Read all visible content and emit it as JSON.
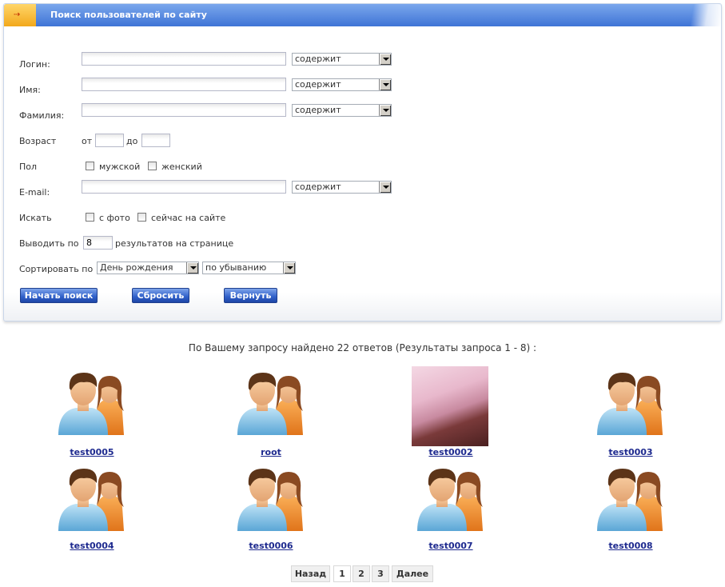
{
  "header": {
    "title": "Поиск пользователей по сайту",
    "arrow": "⇢"
  },
  "form": {
    "login": {
      "label": "Логин:",
      "value": "",
      "mode": "содержит"
    },
    "name": {
      "label": "Имя:",
      "value": "",
      "mode": "содержит"
    },
    "surname": {
      "label": "Фамилия:",
      "value": "",
      "mode": "содержит"
    },
    "age": {
      "label": "Возраст",
      "from_label": "от",
      "to_label": "до",
      "from": "",
      "to": ""
    },
    "gender": {
      "label": "Пол",
      "male": "мужской",
      "female": "женский"
    },
    "email": {
      "label": "E-mail:",
      "value": "",
      "mode": "содержит"
    },
    "search": {
      "label": "Искать",
      "with_photo": "с фото",
      "online": "сейчас на сайте"
    },
    "per_page": {
      "label": "Выводить по",
      "value": "8",
      "suffix": "результатов на странице"
    },
    "sort": {
      "label": "Сортировать по",
      "field": "День рождения",
      "order": "по убыванию"
    },
    "buttons": {
      "search": "Начать поиск",
      "reset": "Сбросить",
      "back": "Вернуть"
    }
  },
  "results": {
    "summary": "По Вашему запросу найдено 22 ответов (Результаты запроса 1 - 8) :",
    "users": [
      {
        "name": "test0005",
        "avatar": "users-icon"
      },
      {
        "name": "root",
        "avatar": "users-icon"
      },
      {
        "name": "test0002",
        "avatar": "user-photo"
      },
      {
        "name": "test0003",
        "avatar": "users-icon"
      },
      {
        "name": "test0004",
        "avatar": "users-icon"
      },
      {
        "name": "test0006",
        "avatar": "users-icon"
      },
      {
        "name": "test0007",
        "avatar": "users-icon"
      },
      {
        "name": "test0008",
        "avatar": "users-icon"
      }
    ]
  },
  "pagination": {
    "prev": "Назад",
    "pages": [
      "1",
      "2",
      "3"
    ],
    "next": "Далее"
  },
  "colors": {
    "header_blue": "#3f74d6",
    "link": "#1e2a8f",
    "button_blue": "#2f5fc9"
  }
}
